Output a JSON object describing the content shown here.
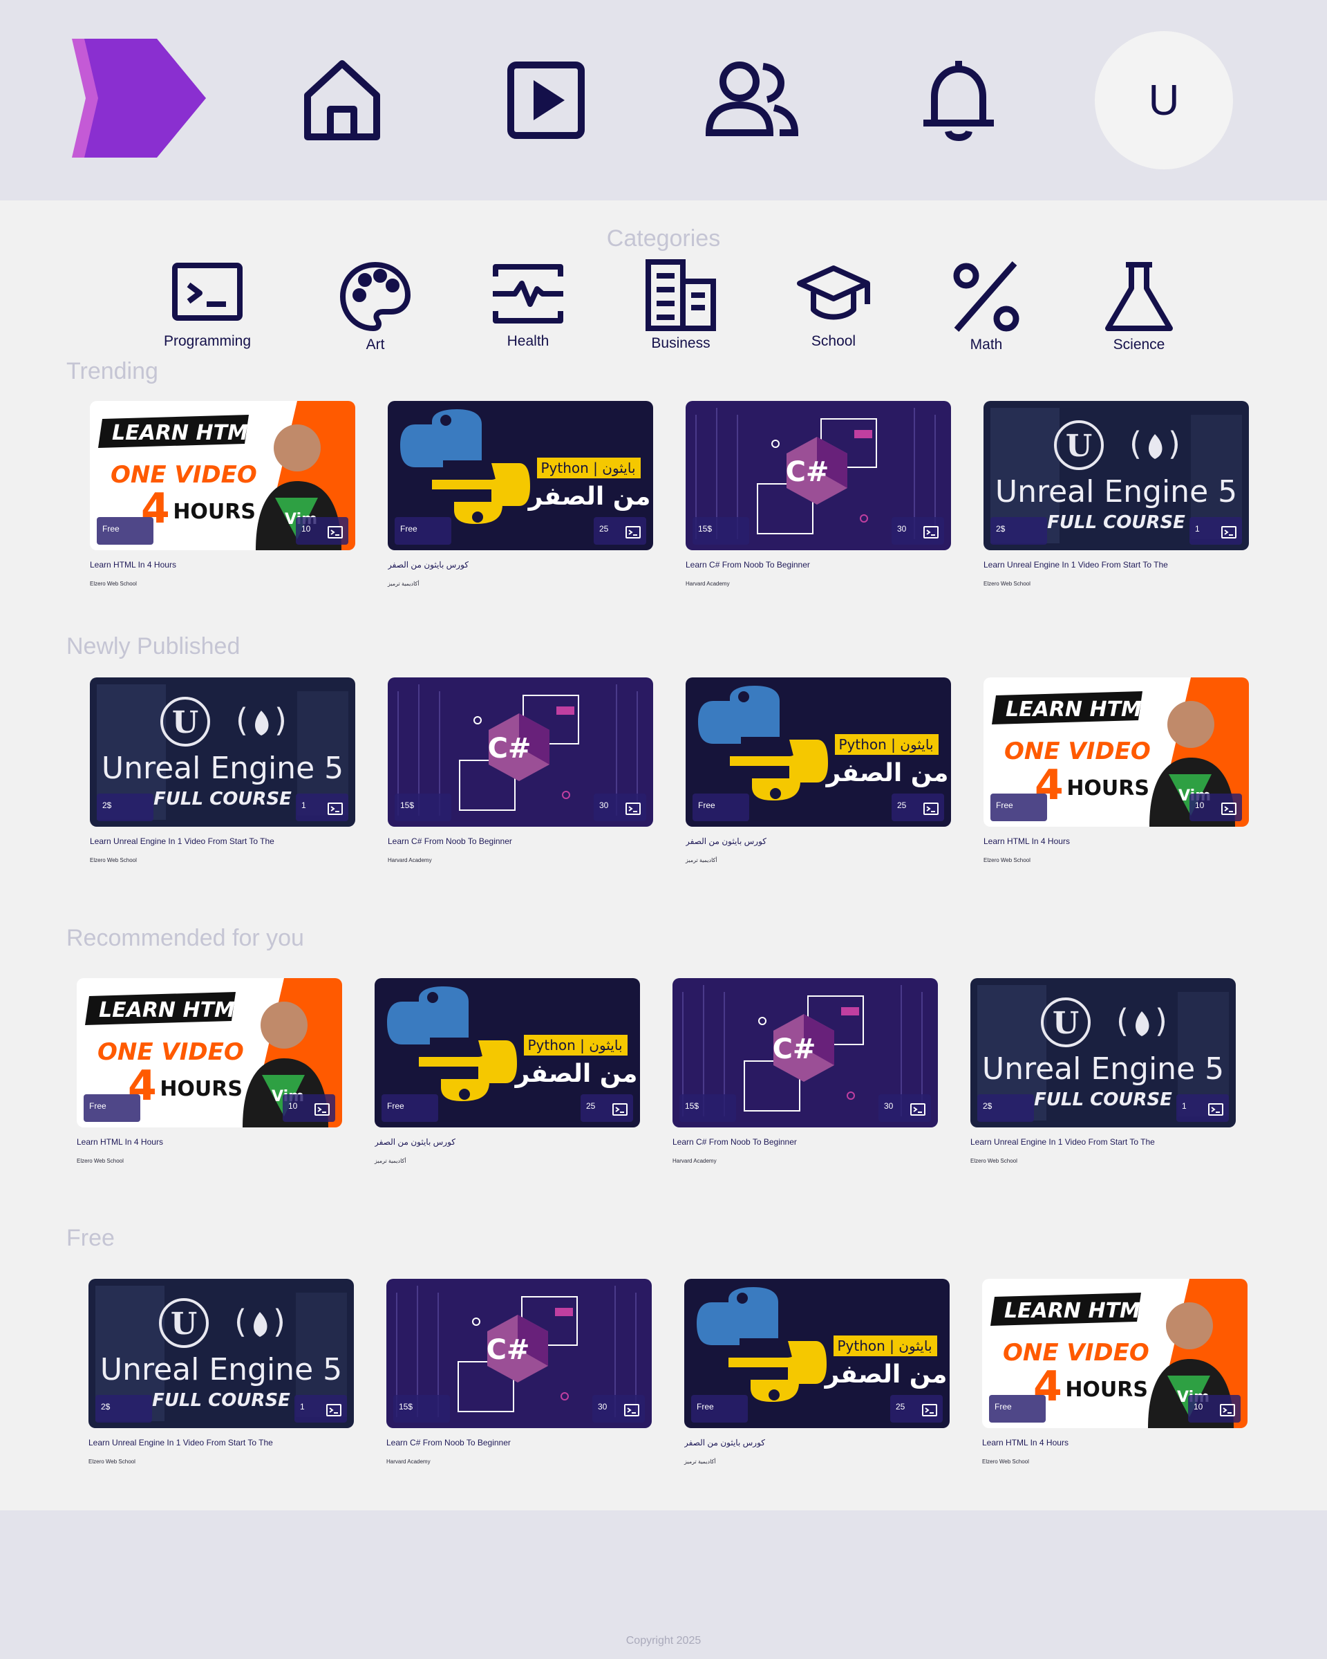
{
  "nav": {
    "avatar_letter": "U",
    "icons": [
      "home-icon",
      "play-icon",
      "users-icon",
      "bell-icon"
    ]
  },
  "categories": {
    "title": "Categories",
    "items": [
      {
        "label": "Programming",
        "icon": "terminal-icon"
      },
      {
        "label": "Art",
        "icon": "palette-icon"
      },
      {
        "label": "Health",
        "icon": "heartbeat-icon"
      },
      {
        "label": "Business",
        "icon": "building-icon"
      },
      {
        "label": "School",
        "icon": "graduation-cap-icon"
      },
      {
        "label": "Math",
        "icon": "percent-icon"
      },
      {
        "label": "Science",
        "icon": "flask-icon"
      }
    ]
  },
  "courses": {
    "html": {
      "title": "Learn HTML In 4 Hours",
      "author": "Elzero Web School",
      "price": "Free",
      "lessons": "10",
      "art": {
        "line1": "LEARN HTML",
        "line2": "ONE VIDEO",
        "line3_num": "4",
        "line3": "HOURS",
        "badge": "Vim"
      }
    },
    "python": {
      "title": "كورس بايثون من الصفر",
      "author": "أكاديمية ترميز",
      "price": "Free",
      "lessons": "25",
      "art": {
        "tag": "Python | بايثون",
        "headline": "من الصفر"
      }
    },
    "csharp": {
      "title": "Learn C# From Noob To Beginner",
      "author": "Harvard Academy",
      "price": "15$",
      "lessons": "30",
      "art": {
        "logo": "C#"
      }
    },
    "unreal": {
      "title": "Learn Unreal Engine In 1 Video From Start To The",
      "author": "Elzero Web School",
      "price": "2$",
      "lessons": "1",
      "art": {
        "line1": "Unreal Engine 5",
        "line2": "FULL COURSE",
        "logo": "U"
      }
    }
  },
  "sections": [
    {
      "title": "Trending",
      "courses": [
        "html",
        "python",
        "csharp",
        "unreal"
      ]
    },
    {
      "title": "Newly Published",
      "courses": [
        "unreal",
        "csharp",
        "python",
        "html"
      ]
    },
    {
      "title": "Recommended for you",
      "courses": [
        "html",
        "python",
        "csharp",
        "unreal"
      ]
    },
    {
      "title": "Free",
      "courses": [
        "unreal",
        "csharp",
        "python",
        "html"
      ]
    }
  ],
  "footer": {
    "copyright": "Copyright 2025"
  },
  "colors": {
    "brand": "#8a2fd0",
    "navy": "#14104a",
    "topbar": "#e3e3eb",
    "muted": "#c5c5d4",
    "orange": "#ff5a00"
  }
}
